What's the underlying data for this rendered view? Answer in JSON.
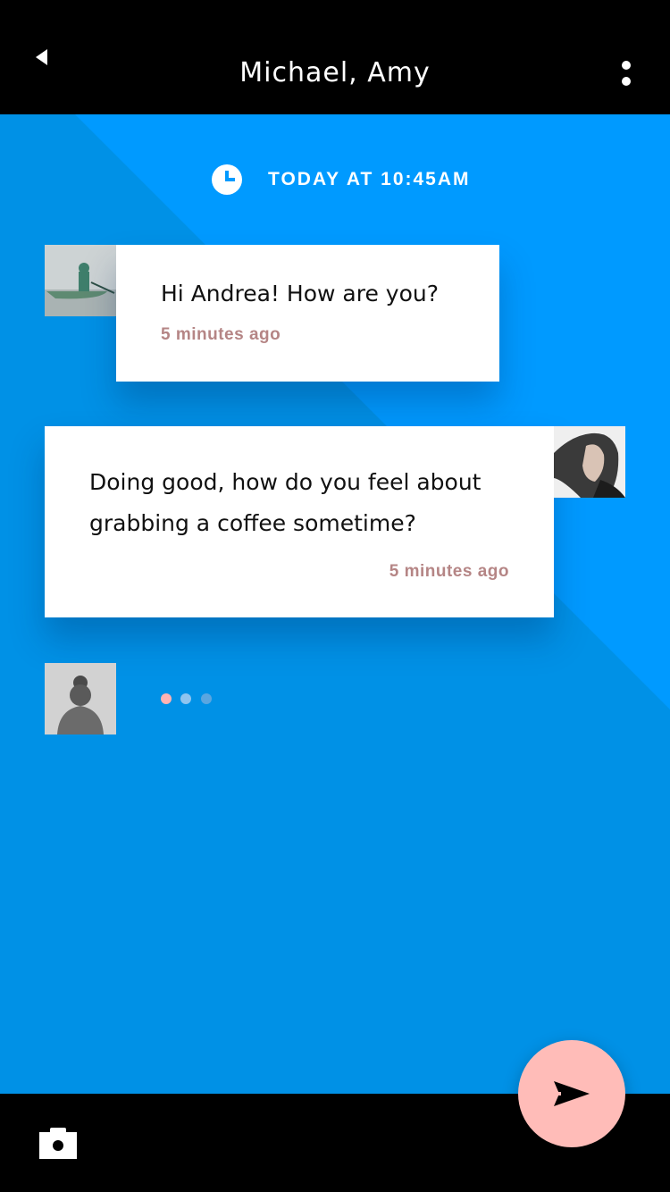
{
  "header": {
    "title": "Michael, Amy",
    "back_icon": "back-arrow-icon",
    "more_icon": "more-vertical-icon"
  },
  "conversation": {
    "timestamp_label": "TODAY AT 10:45AM",
    "messages": [
      {
        "side": "left",
        "text": "Hi Andrea! How are you?",
        "time": "5 minutes ago",
        "avatar": "avatar-man-in-canoe"
      },
      {
        "side": "right",
        "line1": "Doing good, how do you feel about",
        "line2": "grabbing a coffee sometime?",
        "time": "5 minutes ago",
        "avatar": "avatar-woman-long-hair"
      }
    ],
    "typing": {
      "avatar": "avatar-woman-back-view",
      "dot_colors": [
        "#ffb3b3",
        "#8fc4ef",
        "#5aa6e0"
      ]
    }
  },
  "footer": {
    "camera_icon": "camera-icon",
    "send_icon": "send-icon"
  },
  "colors": {
    "background": "#0091e6",
    "background_light": "#009aff",
    "bars": "#000000",
    "send_button": "#ffbcb8",
    "time_text": "#b58585"
  }
}
